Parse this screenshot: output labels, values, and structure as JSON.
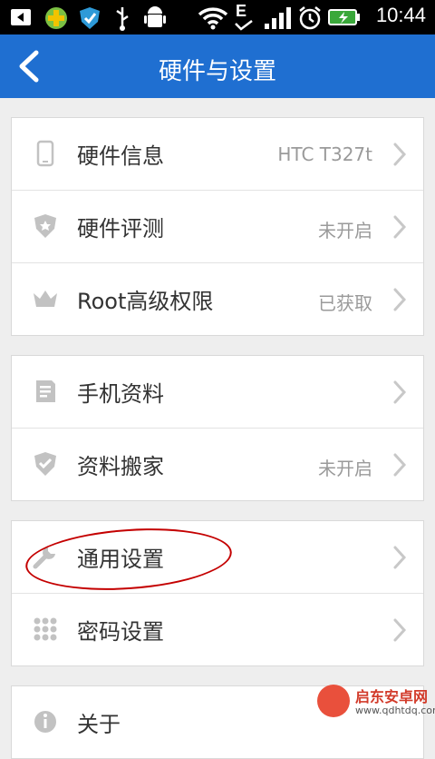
{
  "status_bar": {
    "time": "10:44",
    "network_letter": "E"
  },
  "header": {
    "title": "硬件与设置"
  },
  "groups": [
    {
      "rows": [
        {
          "icon": "phone-icon",
          "label": "硬件信息",
          "value": "HTC T327t"
        },
        {
          "icon": "shield-icon",
          "label": "硬件评测",
          "value": "未开启"
        },
        {
          "icon": "crown-icon",
          "label": "Root高级权限",
          "value": "已获取"
        }
      ]
    },
    {
      "rows": [
        {
          "icon": "document-icon",
          "label": "手机资料",
          "value": ""
        },
        {
          "icon": "shield-check-icon",
          "label": "资料搬家",
          "value": "未开启"
        }
      ]
    },
    {
      "rows": [
        {
          "icon": "wrench-icon",
          "label": "通用设置",
          "value": ""
        },
        {
          "icon": "keypad-icon",
          "label": "密码设置",
          "value": ""
        }
      ]
    },
    {
      "rows": [
        {
          "icon": "info-icon",
          "label": "关于",
          "value": ""
        }
      ]
    }
  ],
  "watermark": {
    "line1": "启东安卓网",
    "line2": "www.qdhtdq.com"
  },
  "colors": {
    "header": "#1f6fd1",
    "highlight_oval": "#c40000"
  }
}
